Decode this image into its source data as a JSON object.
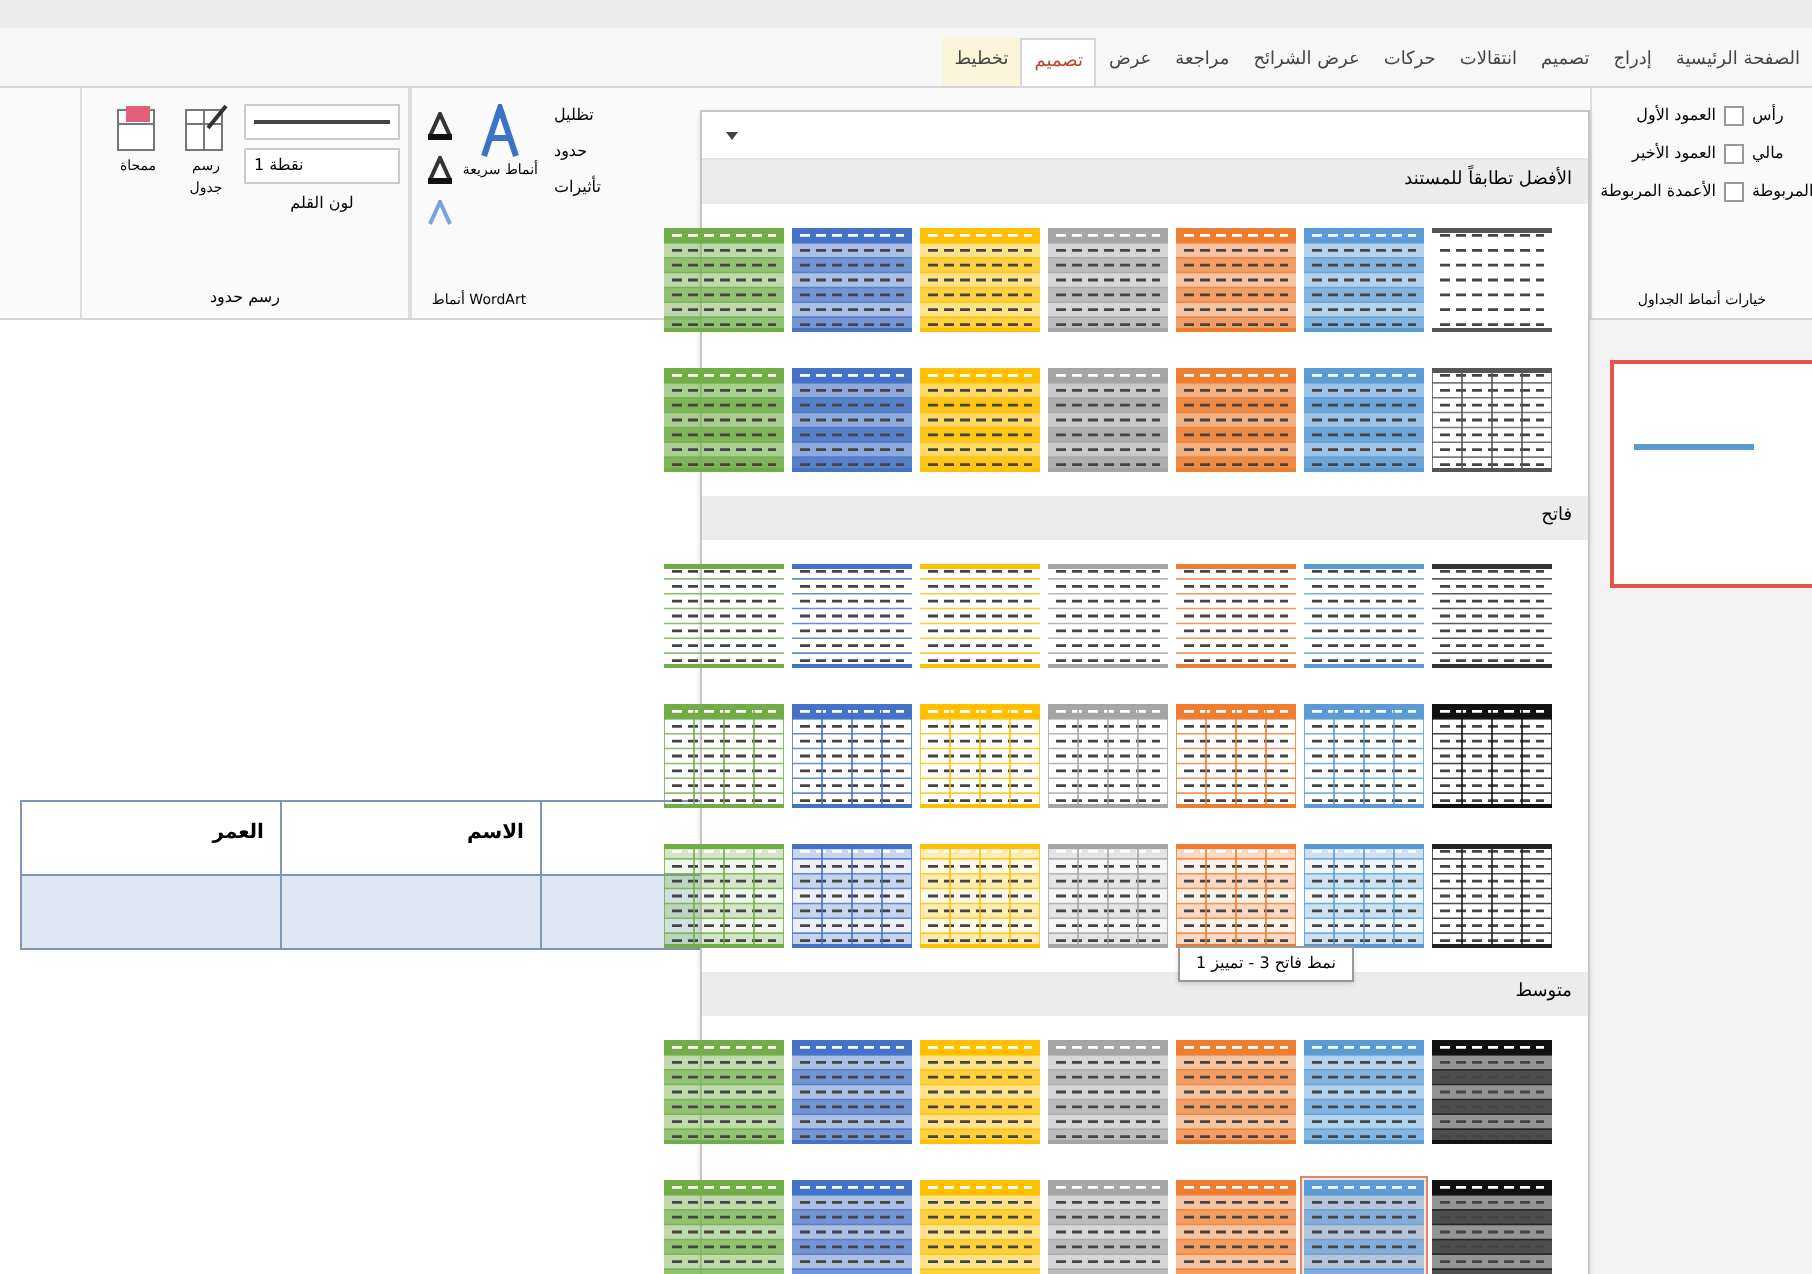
{
  "tabs": [
    {
      "label": "الصفحة الرئيسية",
      "selected": false,
      "contextual": false
    },
    {
      "label": "إدراج",
      "selected": false,
      "contextual": false
    },
    {
      "label": "تصميم",
      "selected": false,
      "contextual": false
    },
    {
      "label": "انتقالات",
      "selected": false,
      "contextual": false
    },
    {
      "label": "حركات",
      "selected": false,
      "contextual": false
    },
    {
      "label": "عرض الشرائح",
      "selected": false,
      "contextual": false
    },
    {
      "label": "مراجعة",
      "selected": false,
      "contextual": false
    },
    {
      "label": "عرض",
      "selected": false,
      "contextual": false
    },
    {
      "label": "تصميم",
      "selected": true,
      "contextual": true
    },
    {
      "label": "تخطيط",
      "selected": false,
      "contextual": true
    }
  ],
  "style_options": {
    "label": "خيارات أنماط الجداول",
    "cut_labels": [
      "رأس",
      "مالي",
      "المربوطة"
    ],
    "checkboxes": [
      {
        "label": "العمود الأول",
        "checked": false
      },
      {
        "label": "العمود الأخير",
        "checked": false
      },
      {
        "label": "الأعمدة المربوطة",
        "checked": false
      }
    ]
  },
  "shading_group": {
    "items": [
      "تظليل",
      "حدود",
      "تأثيرات"
    ]
  },
  "wordart_group": {
    "label": "أنماط WordArt",
    "quick_styles": "أنماط سريعة"
  },
  "borders_group": {
    "label": "رسم حدود",
    "pen_weight": "1 نقطة",
    "pen_color": "لون القلم",
    "draw_table": "رسم جدول",
    "eraser": "ممحاة"
  },
  "gallery": {
    "sections": [
      {
        "label": "الأفضل تطابقاً للمستند",
        "rows": [
          [
            {
              "kind": "plain",
              "color": "#555555",
              "selected": false
            },
            {
              "kind": "banded",
              "color": "#5b9bd5",
              "selected": false
            },
            {
              "kind": "banded",
              "color": "#ed7d31",
              "selected": false
            },
            {
              "kind": "banded",
              "color": "#a5a5a5",
              "selected": false
            },
            {
              "kind": "banded",
              "color": "#ffc000",
              "selected": false
            },
            {
              "kind": "banded",
              "color": "#4472c4",
              "selected": false
            },
            {
              "kind": "banded",
              "color": "#70ad47",
              "selected": false
            }
          ],
          [
            {
              "kind": "grid",
              "color": "#555555",
              "selected": false
            },
            {
              "kind": "filled",
              "color": "#5b9bd5",
              "selected": false
            },
            {
              "kind": "filled",
              "color": "#ed7d31",
              "selected": false
            },
            {
              "kind": "filled",
              "color": "#a5a5a5",
              "selected": false
            },
            {
              "kind": "filled",
              "color": "#ffc000",
              "selected": false
            },
            {
              "kind": "filled",
              "color": "#4472c4",
              "selected": false
            },
            {
              "kind": "filled",
              "color": "#70ad47",
              "selected": false
            }
          ]
        ]
      },
      {
        "label": "فاتح",
        "rows": [
          [
            {
              "kind": "lines",
              "color": "#333333",
              "selected": false
            },
            {
              "kind": "lines",
              "color": "#5b9bd5",
              "selected": false
            },
            {
              "kind": "lines",
              "color": "#ed7d31",
              "selected": false
            },
            {
              "kind": "lines",
              "color": "#a5a5a5",
              "selected": false
            },
            {
              "kind": "lines",
              "color": "#ffc000",
              "selected": false
            },
            {
              "kind": "lines",
              "color": "#4472c4",
              "selected": false
            },
            {
              "kind": "lines",
              "color": "#70ad47",
              "selected": false
            }
          ],
          [
            {
              "kind": "header",
              "color": "#111111",
              "selected": false
            },
            {
              "kind": "header",
              "color": "#5b9bd5",
              "selected": false
            },
            {
              "kind": "header",
              "color": "#ed7d31",
              "selected": false
            },
            {
              "kind": "header",
              "color": "#a5a5a5",
              "selected": false
            },
            {
              "kind": "header",
              "color": "#ffc000",
              "selected": false
            },
            {
              "kind": "header",
              "color": "#4472c4",
              "selected": false
            },
            {
              "kind": "header",
              "color": "#70ad47",
              "selected": false
            }
          ],
          [
            {
              "kind": "grid",
              "color": "#222222",
              "selected": false
            },
            {
              "kind": "lightgrid",
              "color": "#5b9bd5",
              "selected": false
            },
            {
              "kind": "lightgrid",
              "color": "#ed7d31",
              "selected": false
            },
            {
              "kind": "lightgrid",
              "color": "#a5a5a5",
              "selected": false
            },
            {
              "kind": "lightgrid",
              "color": "#ffc000",
              "selected": false
            },
            {
              "kind": "lightgrid",
              "color": "#4472c4",
              "selected": false
            },
            {
              "kind": "lightgrid",
              "color": "#70ad47",
              "selected": false
            }
          ]
        ]
      },
      {
        "label": "متوسط",
        "rows": [
          [
            {
              "kind": "banded",
              "color": "#111111",
              "selected": false
            },
            {
              "kind": "banded",
              "color": "#5b9bd5",
              "selected": false
            },
            {
              "kind": "banded",
              "color": "#ed7d31",
              "selected": false
            },
            {
              "kind": "banded",
              "color": "#a5a5a5",
              "selected": false
            },
            {
              "kind": "banded",
              "color": "#ffc000",
              "selected": false
            },
            {
              "kind": "banded",
              "color": "#4472c4",
              "selected": false
            },
            {
              "kind": "banded",
              "color": "#70ad47",
              "selected": false
            }
          ],
          [
            {
              "kind": "banded",
              "color": "#111111",
              "selected": false
            },
            {
              "kind": "banded",
              "color": "#5b9bd5",
              "selected": true
            },
            {
              "kind": "banded",
              "color": "#ed7d31",
              "selected": false
            },
            {
              "kind": "banded",
              "color": "#a5a5a5",
              "selected": false
            },
            {
              "kind": "banded",
              "color": "#ffc000",
              "selected": false
            },
            {
              "kind": "banded",
              "color": "#4472c4",
              "selected": false
            },
            {
              "kind": "banded",
              "color": "#70ad47",
              "selected": false
            }
          ]
        ]
      }
    ],
    "tooltip": "نمط فاتح 3 - تمييز 1"
  },
  "table": {
    "columns": [
      "الاسم",
      "العمر"
    ]
  }
}
